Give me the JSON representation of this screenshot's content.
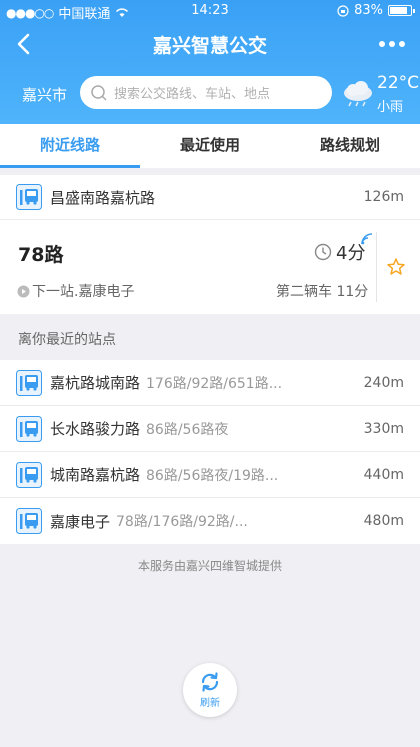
{
  "status_bar": {
    "carrier": "中国联通",
    "time": "14:23",
    "battery": "83%"
  },
  "nav": {
    "title": "嘉兴智慧公交"
  },
  "search": {
    "city": "嘉兴市",
    "placeholder": "搜索公交路线、车站、地点"
  },
  "weather": {
    "temperature": "22°C",
    "description": "小雨",
    "icon": "cloud-rain-icon"
  },
  "tabs": [
    {
      "label": "附近线路",
      "active": true
    },
    {
      "label": "最近使用",
      "active": false
    },
    {
      "label": "路线规划",
      "active": false
    }
  ],
  "nearby_stop": {
    "name": "昌盛南路嘉杭路",
    "distance": "126m"
  },
  "line_card": {
    "route": "78路",
    "next_stop": "下一站.嘉康电子",
    "eta": "4分",
    "second_bus": "第二辆车 11分"
  },
  "section_title": "离你最近的站点",
  "stops": [
    {
      "name": "嘉杭路城南路",
      "routes": "176路/92路/651路...",
      "distance": "240m"
    },
    {
      "name": "长水路骏力路",
      "routes": "86路/56路夜",
      "distance": "330m"
    },
    {
      "name": "城南路嘉杭路",
      "routes": "86路/56路夜/19路...",
      "distance": "440m"
    },
    {
      "name": "嘉康电子",
      "routes": "78路/176路/92路/...",
      "distance": "480m"
    }
  ],
  "footer_note": "本服务由嘉兴四维智城提供",
  "refresh_label": "刷新",
  "colors": {
    "accent": "#3a9cf0",
    "header_gradient_start": "#3aa0f5",
    "header_gradient_end": "#4fb4fb",
    "star": "#f5a623"
  }
}
